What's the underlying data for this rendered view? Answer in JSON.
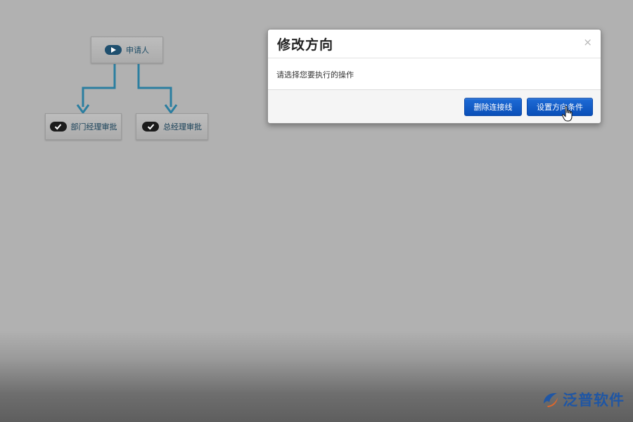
{
  "flow": {
    "start_node": {
      "label": "申请人",
      "icon": "play-icon"
    },
    "approval_nodes": [
      {
        "label": "部门经理审批",
        "icon": "check-icon"
      },
      {
        "label": "总经理审批",
        "icon": "check-icon"
      }
    ],
    "connector_color": "#2b7ea0"
  },
  "modal": {
    "title": "修改方向",
    "close_glyph": "×",
    "message": "请选择您要执行的操作",
    "buttons": {
      "delete_label": "删除连接线",
      "condition_label": "设置方向条件"
    },
    "button_color": "#0a4fb8"
  },
  "watermark": {
    "brand": "泛普软件",
    "icon": "fanpu-logo-icon",
    "color": "#1f56a4"
  }
}
